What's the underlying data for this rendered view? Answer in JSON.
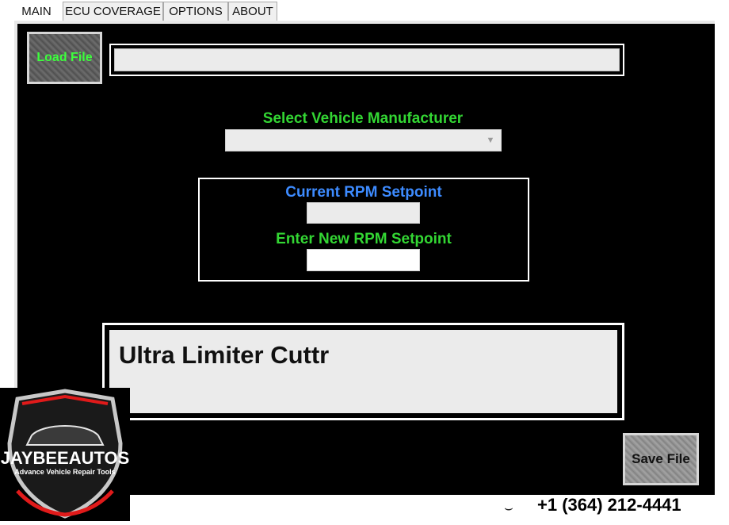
{
  "tabs": [
    {
      "label": "MAIN",
      "active": true
    },
    {
      "label": "ECU COVERAGE"
    },
    {
      "label": "OPTIONS"
    },
    {
      "label": "ABOUT"
    }
  ],
  "buttons": {
    "load_label": "Load File",
    "save_label": "Save File"
  },
  "file_path": {
    "value": ""
  },
  "manufacturer": {
    "label": "Select Vehicle Manufacturer",
    "selected": ""
  },
  "rpm": {
    "current_label": "Current RPM Setpoint",
    "current_value": "",
    "new_label": "Enter New RPM Setpoint",
    "new_value": ""
  },
  "product_title": "Ultra Limiter Cuttr",
  "branding": {
    "name": "JAYBEEAUTOS",
    "tagline": "Advance Vehicle Repair Tools",
    "phone": "+1 (364) 212-4441"
  },
  "colors": {
    "green_label": "#33d633",
    "blue_label": "#3d8bff",
    "load_text": "#3cff3c",
    "panel": "#000000"
  }
}
